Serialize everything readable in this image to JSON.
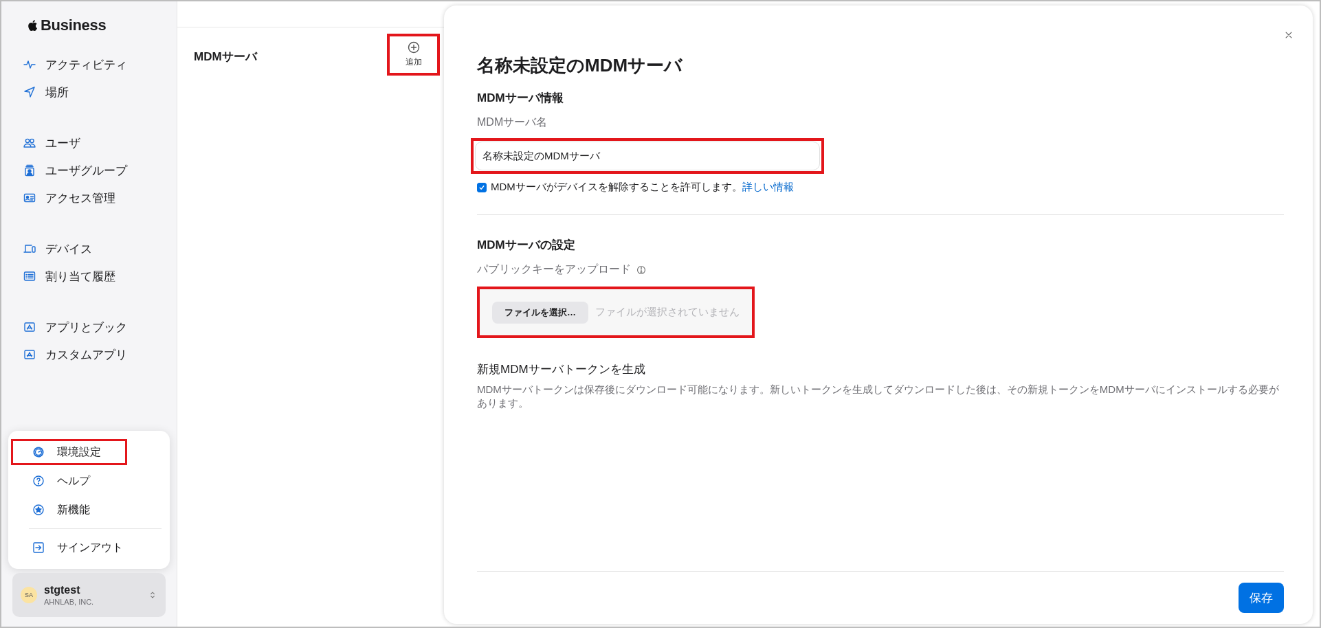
{
  "sidebar": {
    "logo": "Business",
    "groups": [
      {
        "items": [
          {
            "label": "アクティビティ"
          },
          {
            "label": "場所"
          }
        ]
      },
      {
        "items": [
          {
            "label": "ユーザ"
          },
          {
            "label": "ユーザグループ"
          },
          {
            "label": "アクセス管理"
          }
        ]
      },
      {
        "items": [
          {
            "label": "デバイス"
          },
          {
            "label": "割り当て履歴"
          }
        ]
      },
      {
        "items": [
          {
            "label": "アプリとブック"
          },
          {
            "label": "カスタムアプリ"
          }
        ]
      }
    ]
  },
  "account_menu": {
    "items": [
      {
        "label": "環境設定",
        "highlighted": true
      },
      {
        "label": "ヘルプ",
        "highlighted": false
      },
      {
        "label": "新機能",
        "highlighted": false
      },
      {
        "label": "サインアウト",
        "highlighted": false
      }
    ]
  },
  "account": {
    "initials": "SA",
    "name": "stgtest",
    "organization": "AHNLAB, INC."
  },
  "list_pane": {
    "title": "MDMサーバ",
    "add_button": {
      "label": "追加",
      "highlighted": true
    }
  },
  "panel": {
    "title": "名称未設定のMDMサーバ",
    "info_section": {
      "heading": "MDMサーバ情報",
      "name_label": "MDMサーバ名",
      "name_value": "名称未設定のMDMサーバ",
      "name_highlighted": true,
      "allow_release": {
        "label": "MDMサーバがデバイスを解除することを許可します。",
        "link": "詳しい情報",
        "checked": true
      }
    },
    "settings_section": {
      "heading": "MDMサーバの設定",
      "key_label": "パブリックキーをアップロード",
      "file_button": "ファイルを選択…",
      "file_status": "ファイルが選択されていません",
      "file_highlighted": true,
      "token_heading": "新規MDMサーバトークンを生成",
      "token_description": "MDMサーバトークンは保存後にダウンロード可能になります。新しいトークンを生成してダウンロードした後は、その新規トークンをMDMサーバにインストールする必要があります。"
    },
    "save_button": "保存"
  }
}
